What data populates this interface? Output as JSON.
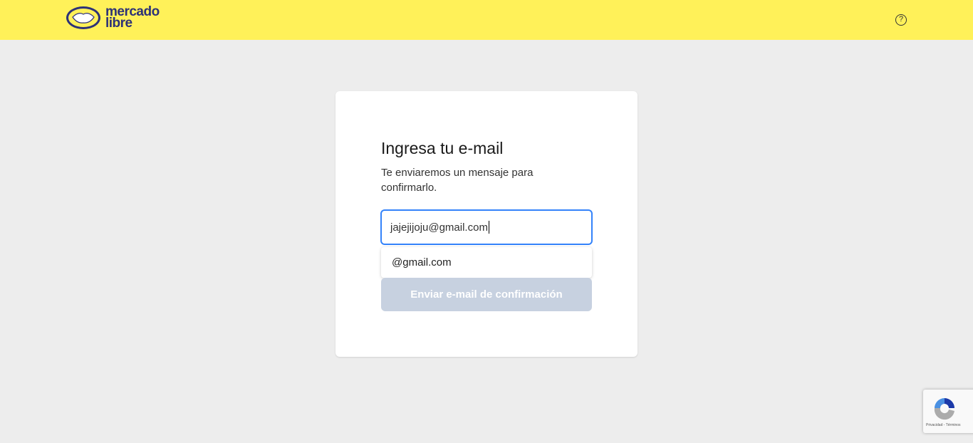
{
  "header": {
    "logo_text_line1": "mercado",
    "logo_text_line2": "libre",
    "help_icon": "?"
  },
  "card": {
    "title": "Ingresa tu e-mail",
    "subtitle": "Te enviaremos un mensaje para confirmarlo.",
    "email_value": "jajejijoju@gmail.com",
    "suggestion": "@gmail.com",
    "submit_label": "Enviar e-mail de confirmación"
  },
  "recaptcha": {
    "links": "Privacidad - Términos"
  },
  "colors": {
    "header": "#fff159",
    "accent": "#3483fa",
    "disabled_button": "#c7d1e0"
  }
}
